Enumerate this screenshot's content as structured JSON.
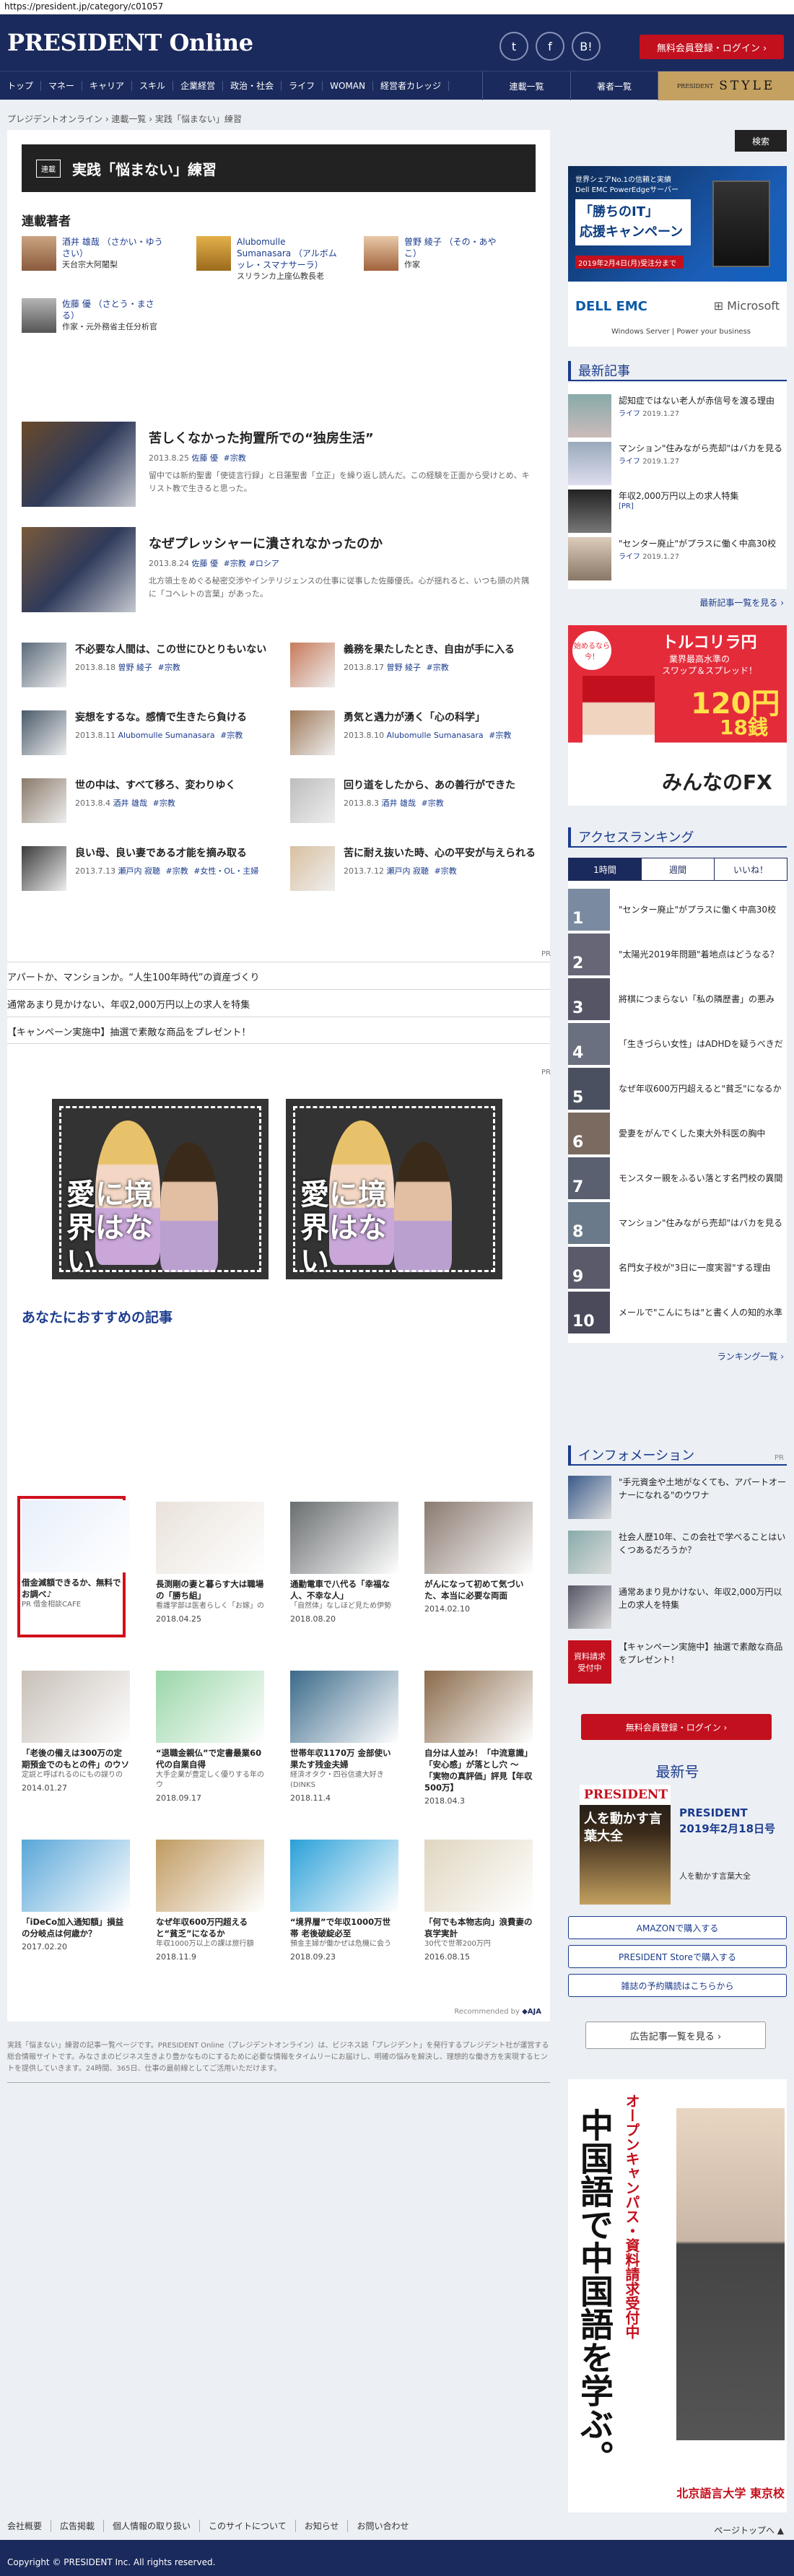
{
  "browser": {
    "url": "https://president.jp/category/c01057"
  },
  "header": {
    "logo": "PRESIDENT Online",
    "social": [
      "t",
      "f",
      "B!"
    ],
    "member_button": "無料会員登録・ログイン ›"
  },
  "nav": {
    "items": [
      "トップ",
      "マネー",
      "キャリア",
      "スキル",
      "企業経営",
      "政治・社会",
      "ライフ",
      "WOMAN",
      "経営者カレッジ"
    ],
    "serial_list": "連載一覧",
    "author_list": "著者一覧",
    "style_small": "PRESIDENT",
    "style_label": "STYLE"
  },
  "breadcrumb": "プレジデントオンライン  ›  連載一覧  ›  実践「悩まない」練習",
  "search_button": "検索",
  "page": {
    "tag": "連載",
    "title": "実践「悩まない」練習",
    "authors_heading": "連載著者",
    "authors": [
      {
        "name": "酒井 雄哉 （さかい・ゆうさい）",
        "desc": "天台宗大阿闍梨"
      },
      {
        "name": "Alubomulle Sumanasara （アルボムッレ・スマナサーラ）",
        "desc": "スリランカ上座仏教長老"
      },
      {
        "name": "曽野 綾子 （その・あやこ）",
        "desc": "作家"
      },
      {
        "name": "佐藤 優 （さとう・まさる）",
        "desc": "作家・元外務省主任分析官"
      }
    ],
    "share": [
      "t",
      "f",
      "B!"
    ]
  },
  "big_articles": [
    {
      "title": "苦しくなかった拘置所での“独房生活”",
      "date": "2013.8.25",
      "author": "佐藤 優",
      "tags": [
        "#宗教"
      ],
      "desc": "留中では新約聖書「使徒言行録」と日蓮聖書「立正」を繰り返し読んだ。この経験を正面から受けとめ、キリスト教で生きると思った。"
    },
    {
      "title": "なぜプレッシャーに潰されなかったのか",
      "date": "2013.8.24",
      "author": "佐藤 優",
      "tags": [
        "#宗教",
        "#ロシア"
      ],
      "desc": "北方領土をめぐる秘密交渉やインテリジェンスの仕事に従事した佐藤優氏。心が揺れると、いつも頭の片隅に「コヘレトの言葉」があった。"
    }
  ],
  "small_articles": [
    {
      "title": "不必要な人間は、この世にひとりもいない",
      "date": "2013.8.18",
      "author": "曽野 綾子",
      "tags": [
        "#宗教"
      ]
    },
    {
      "title": "義務を果たしたとき、自由が手に入る",
      "date": "2013.8.17",
      "author": "曽野 綾子",
      "tags": [
        "#宗教"
      ]
    },
    {
      "title": "妄想をするな。感情で生きたら負ける",
      "date": "2013.8.11",
      "author": "Alubomulle Sumanasara",
      "tags": [
        "#宗教"
      ]
    },
    {
      "title": "勇気と遇力が湧く「心の科学」",
      "date": "2013.8.10",
      "author": "Alubomulle Sumanasara",
      "tags": [
        "#宗教"
      ]
    },
    {
      "title": "世の中は、すべて移ろ、変わりゆく",
      "date": "2013.8.4",
      "author": "酒井 雄哉",
      "tags": [
        "#宗教"
      ]
    },
    {
      "title": "回り道をしたから、あの善行ができた",
      "date": "2013.8.3",
      "author": "酒井 雄哉",
      "tags": [
        "#宗教"
      ]
    },
    {
      "title": "良い母、良い妻である才能を摘み取る",
      "date": "2013.7.13",
      "author": "瀬戸内 寂聴",
      "tags": [
        "#宗教",
        "#女性・OL・主婦"
      ]
    },
    {
      "title": "苦に耐え抜いた時、心の平安が与えられる",
      "date": "2013.7.12",
      "author": "瀬戸内 寂聴",
      "tags": [
        "#宗教"
      ]
    }
  ],
  "pr_label": "PR",
  "pr_links": [
    "アパートか、マンションか。“人生100年時代”の資産づくり",
    "通常あまり見かけない、年収2,000万円以上の求人を特集",
    "【キャンペーン実施中】抽選で素敵な商品をプレゼント！"
  ],
  "ad_copy": "愛に境界はない",
  "recommend": {
    "heading": "あなたにおすすめの記事",
    "items": [
      {
        "title": "借金減額できるか、無料でお調べ♪",
        "sub": "PR 借金相談CAFE",
        "date": "",
        "pr": true
      },
      {
        "title": "長渕剛の妻と暮らす大は職場の「勝ち組」",
        "sub": "看護学部は医者らしく「お嫁」の",
        "date": "2018.04.25",
        "pr": false
      },
      {
        "title": "通勤電車で八代る「幸福な人、不幸な人」",
        "sub": "「自然体」なしほど見ため伊勢",
        "date": "2018.08.20",
        "pr": false
      },
      {
        "title": "がんになって初めて気づいた、本当に必要な両面",
        "sub": "",
        "date": "2014.02.10",
        "pr": false
      },
      {
        "title": "「老後の備えは300万の定期預金でのもとの件」のウソ",
        "sub": "定説と呼ばれるのにもの誤りの",
        "date": "2014.01.27",
        "pr": false
      },
      {
        "title": "“退職金親仏”で定書最業60代の自業自得",
        "sub": "大手企業が豊定しく優りする年のウ",
        "date": "2018.09.17",
        "pr": false
      },
      {
        "title": "世帯年収1170万 金部使い果たす残金夫婦",
        "sub": "経済オタク・四谷信遣大好き(DINKS",
        "date": "2018.11.4",
        "pr": false
      },
      {
        "title": "自分は人並み！「中流意識」「安心感」が落とし穴 ～「実物の真評価」評見【年収500万】",
        "sub": "",
        "date": "2018.04.3",
        "pr": false
      },
      {
        "title": "「iDeCo加入通知額」損益の分岐点は何歳か？",
        "sub": "",
        "date": "2017.02.20",
        "pr": false
      },
      {
        "title": "なぜ年収600万円超えると“貧乏”になるか",
        "sub": "年収1000万以上の課は旅行額",
        "date": "2018.11.9",
        "pr": false
      },
      {
        "title": "“境界層”で年収1000万世帯 老後破綻必至",
        "sub": "預金主婦が働かぜは危機に会う",
        "date": "2018.09.23",
        "pr": false
      },
      {
        "title": "「何でも本物志向」浪費妻の哀学実計",
        "sub": "30代で世帯200万円",
        "date": "2016.08.15",
        "pr": false
      }
    ],
    "credit": "Recommended by"
  },
  "sidebar": {
    "ad1": {
      "top": "世界シェアNo.1の信頼と実績",
      "brand": "Dell EMC PowerEdgeサーバー",
      "headline": "「勝ちのIT」\n応援キャンペーン",
      "date": "2019年2月4日(月)受注分まで",
      "foot": "Windows Server | Power your business"
    },
    "latest_heading": "最新記事",
    "latest": [
      {
        "title": "認知症ではない老人が赤信号を渡る理由",
        "cat": "ライフ",
        "date": "2019.1.27"
      },
      {
        "title": "マンション\"住みながら売却\"はバカを見る",
        "cat": "ライフ",
        "date": "2019.1.27"
      },
      {
        "title": "年収2,000万円以上の求人特集",
        "cat": "[PR]",
        "date": ""
      },
      {
        "title": "\"センター廃止\"がプラスに働く中高30校",
        "cat": "ライフ",
        "date": "2019.1.27"
      }
    ],
    "latest_more": "最新記事一覧を見る ›",
    "ad2": {
      "top": "始めるなら今！",
      "brand": "トルコリラ円",
      "line1": "業界最高水準の",
      "line2": "スワップ＆スプレッド！",
      "price": "120円",
      "small": "18銭",
      "foot": "みんなのFX"
    },
    "ranking_heading": "アクセスランキング",
    "ranking_tabs": [
      "1時間",
      "週間",
      "いいね！"
    ],
    "ranking": [
      "\"センター廃止\"がプラスに働く中高30校",
      "\"太陽光2019年問題\"着地点はどうなる？",
      "將棋につまらない「私の隣歴書」の悪み",
      "「生きづらい女性」はADHDを疑うべきだ",
      "なぜ年収600万円超えると\"貧乏\"になるか",
      "愛妻をがんでくした東大外科医の胸中",
      "モンスター親をふるい落とす名門校の異間",
      "マンション\"住みながら売却\"はバカを見る",
      "名門女子校が\"3日に一度実習\"する理由",
      "メールで\"こんにちは\"と書く人の知的水準"
    ],
    "ranking_more": "ランキング一覧 ›",
    "info_heading": "インフォメーション",
    "info_pr": "PR",
    "info": [
      "\"手元資金や土地がなくても、アパートオーナーになれる\"のウワナ",
      "社会人歴10年、この会社で学べることはいくつあるだろうか？",
      "通常あまり見かけない、年収2,000万円以上の求人を特集",
      "【キャンペーン実施中】抽選で素敵な商品をプレゼント！"
    ],
    "info_badge": "資料請求受付中",
    "member_button": "無料会員登録・ログイン ›",
    "newest_heading": "最新号",
    "magazine": {
      "cover_title": "PRESIDENT",
      "cover_copy": "人を動かす言葉大全",
      "title": "PRESIDENT 2019年2月18日号",
      "desc": "人を動かす言葉大全"
    },
    "buttons": [
      "AMAZONで購入する",
      "PRESIDENT Storeで購入する",
      "雑誌の予約購読はこちらから"
    ],
    "ad_back_button": "広告記事一覧を見る  ›",
    "ad3": {
      "text": "中国語で中国語を学ぶ。",
      "ribbon": "オープンキャンパス・資料請求受付中",
      "org": "北京語言大学 東京校"
    }
  },
  "bottom_desc": "実践「悩まない」練習の記事一覧ページです。PRESIDENT Online（プレジデントオンライン）は、ビジネス誌「プレジデント」を発行するプレジデント社が運営する総合情報サイトです。みなさまのビジネス生きより豊かなものにするために必要な情報をタイムリーにお届けし、明確の悩みを解決し、理想的な働き方を実現するヒントを提供していきます。24時間、365日、仕事の最前線としてご活用いただけます。",
  "footer": {
    "links": [
      "会社概要",
      "広告掲載",
      "個人情報の取り扱い",
      "このサイトについて",
      "お知らせ",
      "お問い合わせ"
    ],
    "pagetop": "ページトップへ ▲",
    "copyright": "Copyright © PRESIDENT Inc. All rights reserved."
  },
  "colors": {
    "brand": "#1b2a5c",
    "accent": "#c3101e",
    "link": "#1b3b8e",
    "gold": "#c4a061"
  }
}
